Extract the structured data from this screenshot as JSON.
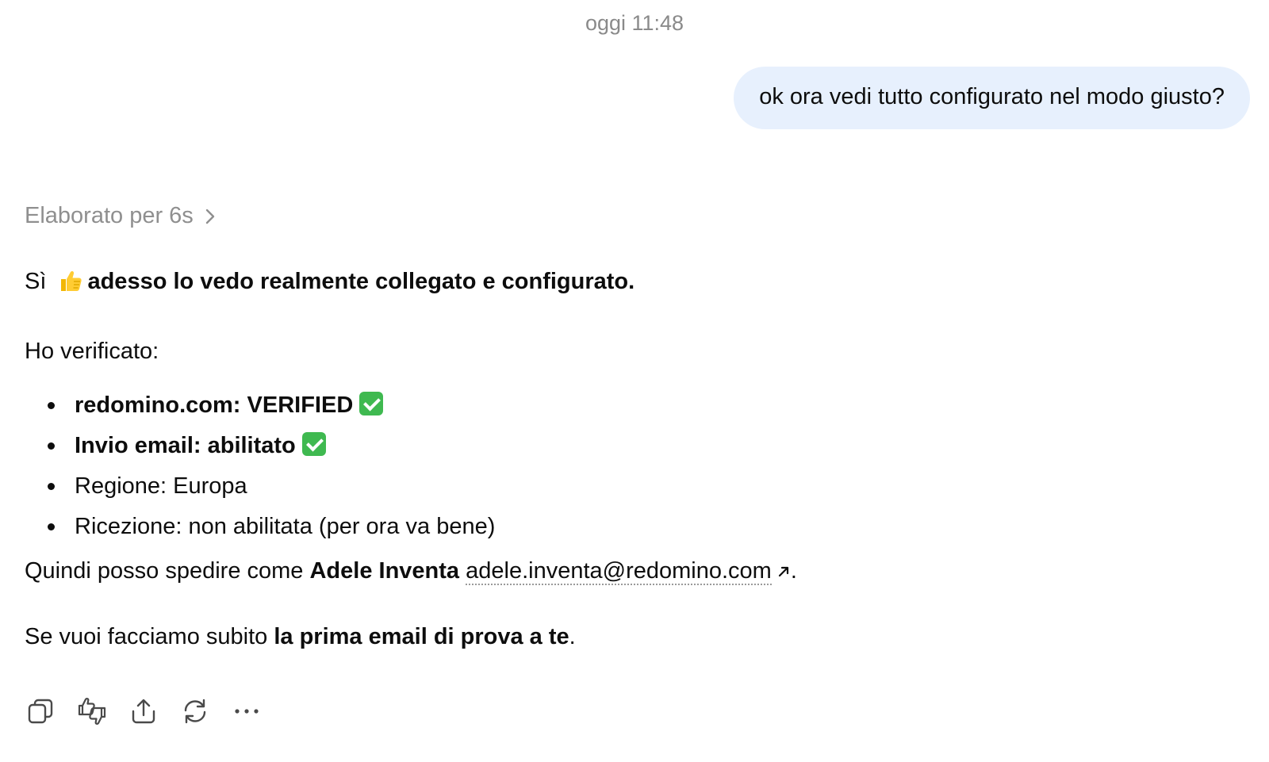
{
  "timestamp": "oggi 11:48",
  "user_message": "ok ora vedi tutto configurato nel modo giusto?",
  "thinking": {
    "label": "Elaborato per 6s",
    "icon": "chevron-right-icon"
  },
  "assistant": {
    "intro_prefix": "Sì",
    "intro_emoji": "thumbs-up-emoji",
    "intro_bold": "adesso lo vedo realmente collegato e configurato.",
    "verified_heading": "Ho verificato:",
    "checks": [
      {
        "text": "redomino.com: VERIFIED",
        "bold": true,
        "emoji": "check-mark-button-emoji"
      },
      {
        "text": "Invio email: abilitato",
        "bold": true,
        "emoji": "check-mark-button-emoji"
      },
      {
        "text": "Regione: Europa",
        "bold": false
      },
      {
        "text": "Ricezione: non abilitata (per ora va bene)",
        "bold": false
      }
    ],
    "quindi_prefix": "Quindi posso spedire come ",
    "sender_name": "Adele Inventa",
    "sender_email": "adele.inventa@redomino.com",
    "quindi_suffix": ".",
    "proposal_prefix": "Se vuoi facciamo subito ",
    "proposal_bold": "la prima email di prova a te",
    "proposal_suffix": "."
  },
  "actions": [
    {
      "name": "copy-button",
      "icon": "copy-icon"
    },
    {
      "name": "feedback-button",
      "icon": "thumbs-icon"
    },
    {
      "name": "share-button",
      "icon": "share-icon"
    },
    {
      "name": "regenerate-button",
      "icon": "refresh-icon"
    },
    {
      "name": "more-button",
      "icon": "more-horizontal-icon"
    }
  ],
  "colors": {
    "user_bubble": "#e7f0fd",
    "muted_text": "#8f8f8f",
    "check_green": "#3fb950"
  }
}
